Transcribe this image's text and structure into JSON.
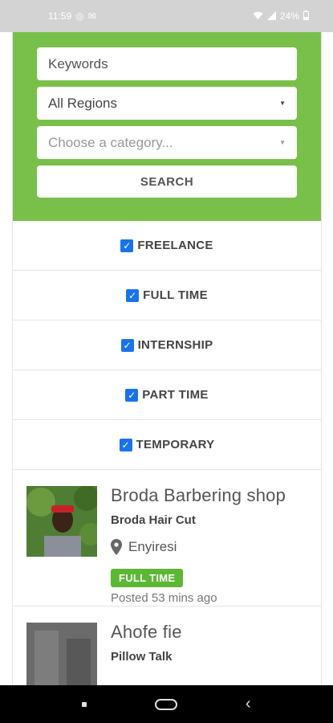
{
  "status_bar": {
    "time": "11:59",
    "battery": "24%"
  },
  "search": {
    "keywords_placeholder": "Keywords",
    "region_value": "All Regions",
    "category_placeholder": "Choose a category...",
    "button_label": "SEARCH"
  },
  "filters": [
    {
      "label": "FREELANCE",
      "checked": true
    },
    {
      "label": "FULL TIME",
      "checked": true
    },
    {
      "label": "INTERNSHIP",
      "checked": true
    },
    {
      "label": "PART TIME",
      "checked": true
    },
    {
      "label": "TEMPORARY",
      "checked": true
    }
  ],
  "jobs": [
    {
      "title": "Broda Barbering shop",
      "company": "Broda Hair Cut",
      "location": "Enyiresi",
      "type": "FULL TIME",
      "posted": "Posted 53 mins ago"
    },
    {
      "title": "Ahofe fie",
      "company": "Pillow Talk"
    }
  ],
  "colors": {
    "accent_green": "#79c04a",
    "badge_green": "#5cb735",
    "checkbox_blue": "#1a73e8"
  }
}
